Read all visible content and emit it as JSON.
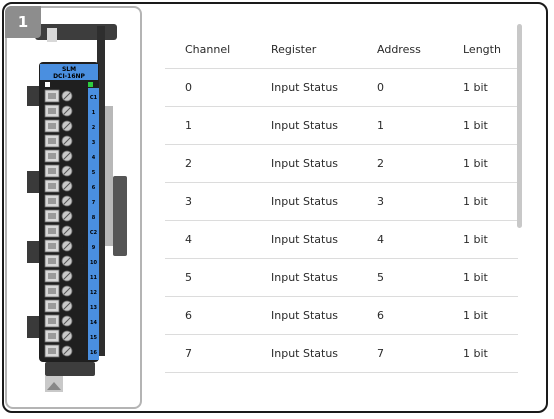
{
  "badge": {
    "number": "1"
  },
  "module": {
    "brand": "SLM",
    "model": "DCI-16NP",
    "terminal_labels": [
      "C1",
      "1",
      "2",
      "3",
      "4",
      "5",
      "6",
      "7",
      "8",
      "C2",
      "9",
      "10",
      "11",
      "12",
      "13",
      "14",
      "15",
      "16"
    ],
    "screw_numbers": [
      "1",
      "2",
      "3",
      "4",
      "5",
      "6",
      "7",
      "8",
      "9",
      "10",
      "11",
      "12",
      "13",
      "14",
      "15",
      "16",
      "17",
      "18"
    ],
    "body_color": "#4a8fe0",
    "led_color": "#2ecc40"
  },
  "table": {
    "headers": [
      "Channel",
      "Register",
      "Address",
      "Length"
    ],
    "rows": [
      [
        "0",
        "Input Status",
        "0",
        "1 bit"
      ],
      [
        "1",
        "Input Status",
        "1",
        "1 bit"
      ],
      [
        "2",
        "Input Status",
        "2",
        "1 bit"
      ],
      [
        "3",
        "Input Status",
        "3",
        "1 bit"
      ],
      [
        "4",
        "Input Status",
        "4",
        "1 bit"
      ],
      [
        "5",
        "Input Status",
        "5",
        "1 bit"
      ],
      [
        "6",
        "Input Status",
        "6",
        "1 bit"
      ],
      [
        "7",
        "Input Status",
        "7",
        "1 bit"
      ]
    ]
  }
}
